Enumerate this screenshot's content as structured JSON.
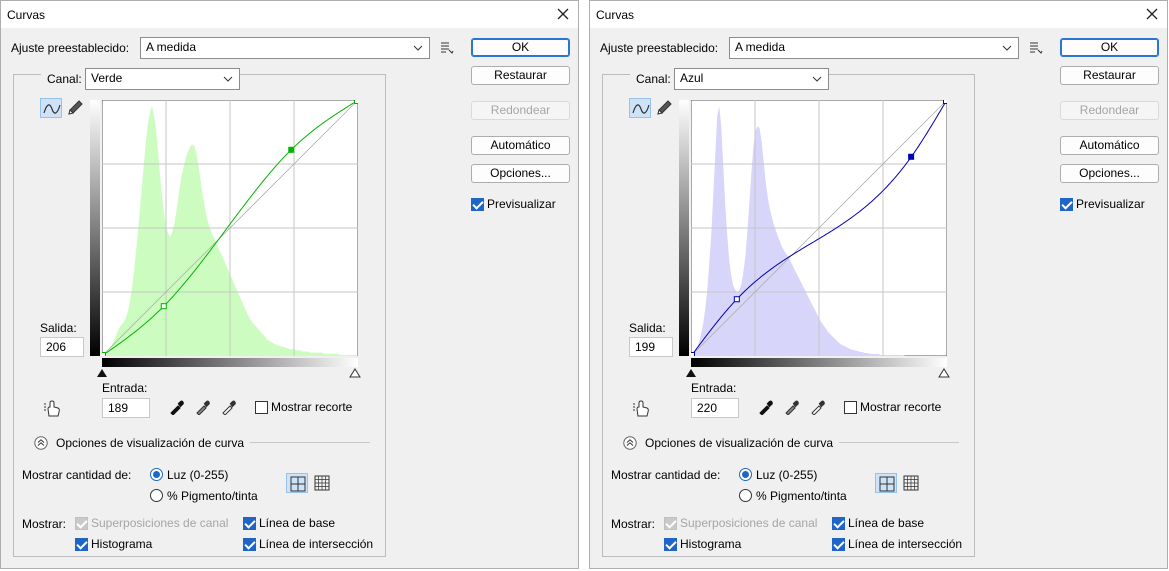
{
  "dialogs": [
    {
      "title": "Curvas",
      "preset": {
        "label": "Ajuste preestablecido:",
        "value": "A medida"
      },
      "channel": {
        "label": "Canal:",
        "value": "Verde"
      },
      "buttons": {
        "ok": "OK",
        "restore": "Restaurar",
        "round": "Redondear",
        "auto": "Automático",
        "options": "Opciones..."
      },
      "preview": {
        "label": "Previsualizar",
        "checked": true
      },
      "output": {
        "label": "Salida:",
        "value": "206"
      },
      "input": {
        "label": "Entrada:",
        "value": "189"
      },
      "show_clipping": "Mostrar recorte",
      "curve_options_title": "Opciones de visualización de curva",
      "show_amount": {
        "label": "Mostrar cantidad de:",
        "light": "Luz (0-255)",
        "pigment": "% Pigmento/tinta",
        "selected": "light"
      },
      "show": {
        "label": "Mostrar:",
        "channel_overlays": "Superposiciones de canal",
        "baseline": "Línea de base",
        "histogram": "Histograma",
        "intersection": "Línea de intersección"
      },
      "colors": {
        "histogram": "#cdfcc0",
        "curve": "#00b400"
      },
      "curve_points": [
        [
          0,
          0
        ],
        [
          61,
          49
        ],
        [
          189,
          206
        ],
        [
          255,
          255
        ]
      ],
      "histogram": [
        0,
        0,
        1,
        3,
        6,
        10,
        14,
        18,
        22,
        26,
        28,
        30,
        34,
        40,
        48,
        60,
        75,
        92,
        110,
        130,
        150,
        170,
        190,
        205,
        215,
        220,
        212,
        200,
        180,
        160,
        140,
        125,
        115,
        108,
        105,
        108,
        115,
        125,
        138,
        150,
        160,
        168,
        175,
        180,
        184,
        186,
        185,
        180,
        170,
        158,
        146,
        135,
        126,
        118,
        112,
        108,
        104,
        100,
        96,
        92,
        88,
        84,
        80,
        76,
        72,
        68,
        64,
        60,
        56,
        52,
        48,
        44,
        40,
        36,
        33,
        30,
        28,
        26,
        24,
        22,
        20,
        18,
        16,
        14,
        13,
        12,
        11,
        10,
        9,
        9,
        8,
        8,
        7,
        7,
        6,
        6,
        6,
        5,
        5,
        5,
        4,
        4,
        4,
        4,
        3,
        3,
        3,
        3,
        3,
        3,
        3,
        2,
        2,
        2,
        2,
        2,
        2,
        2,
        2,
        1,
        1,
        1,
        1,
        1,
        1,
        1,
        1,
        1,
        0
      ]
    },
    {
      "title": "Curvas",
      "preset": {
        "label": "Ajuste preestablecido:",
        "value": "A medida"
      },
      "channel": {
        "label": "Canal:",
        "value": "Azul"
      },
      "buttons": {
        "ok": "OK",
        "restore": "Restaurar",
        "round": "Redondear",
        "auto": "Automático",
        "options": "Opciones..."
      },
      "preview": {
        "label": "Previsualizar",
        "checked": true
      },
      "output": {
        "label": "Salida:",
        "value": "199"
      },
      "input": {
        "label": "Entrada:",
        "value": "220"
      },
      "show_clipping": "Mostrar recorte",
      "curve_options_title": "Opciones de visualización de curva",
      "show_amount": {
        "label": "Mostrar cantidad de:",
        "light": "Luz (0-255)",
        "pigment": "% Pigmento/tinta",
        "selected": "light"
      },
      "show": {
        "label": "Mostrar:",
        "channel_overlays": "Superposiciones de canal",
        "baseline": "Línea de base",
        "histogram": "Histograma",
        "intersection": "Línea de intersección"
      },
      "colors": {
        "histogram": "#d7d5fa",
        "curve": "#0000b4"
      },
      "curve_points": [
        [
          0,
          0
        ],
        [
          45,
          56
        ],
        [
          220,
          199
        ],
        [
          255,
          255
        ]
      ],
      "histogram": [
        0,
        2,
        4,
        8,
        14,
        22,
        32,
        46,
        64,
        90,
        120,
        160,
        200,
        240,
        250,
        230,
        190,
        150,
        120,
        95,
        80,
        70,
        66,
        64,
        66,
        72,
        84,
        100,
        125,
        155,
        185,
        210,
        225,
        230,
        228,
        215,
        195,
        175,
        160,
        148,
        140,
        132,
        126,
        120,
        115,
        110,
        106,
        103,
        100,
        96,
        92,
        88,
        84,
        80,
        76,
        72,
        68,
        64,
        60,
        56,
        52,
        48,
        44,
        40,
        36,
        33,
        30,
        27,
        24,
        22,
        20,
        18,
        16,
        14,
        12,
        11,
        10,
        9,
        8,
        7,
        6,
        6,
        5,
        5,
        4,
        4,
        3,
        3,
        3,
        2,
        2,
        2,
        2,
        2,
        1,
        1,
        1,
        1,
        1,
        1,
        1,
        1,
        1,
        1,
        1,
        1,
        0,
        0,
        0,
        0,
        0,
        0,
        0,
        0,
        0,
        0,
        0,
        0,
        0,
        0,
        0,
        0,
        0,
        0,
        0,
        0,
        0,
        0
      ]
    }
  ]
}
